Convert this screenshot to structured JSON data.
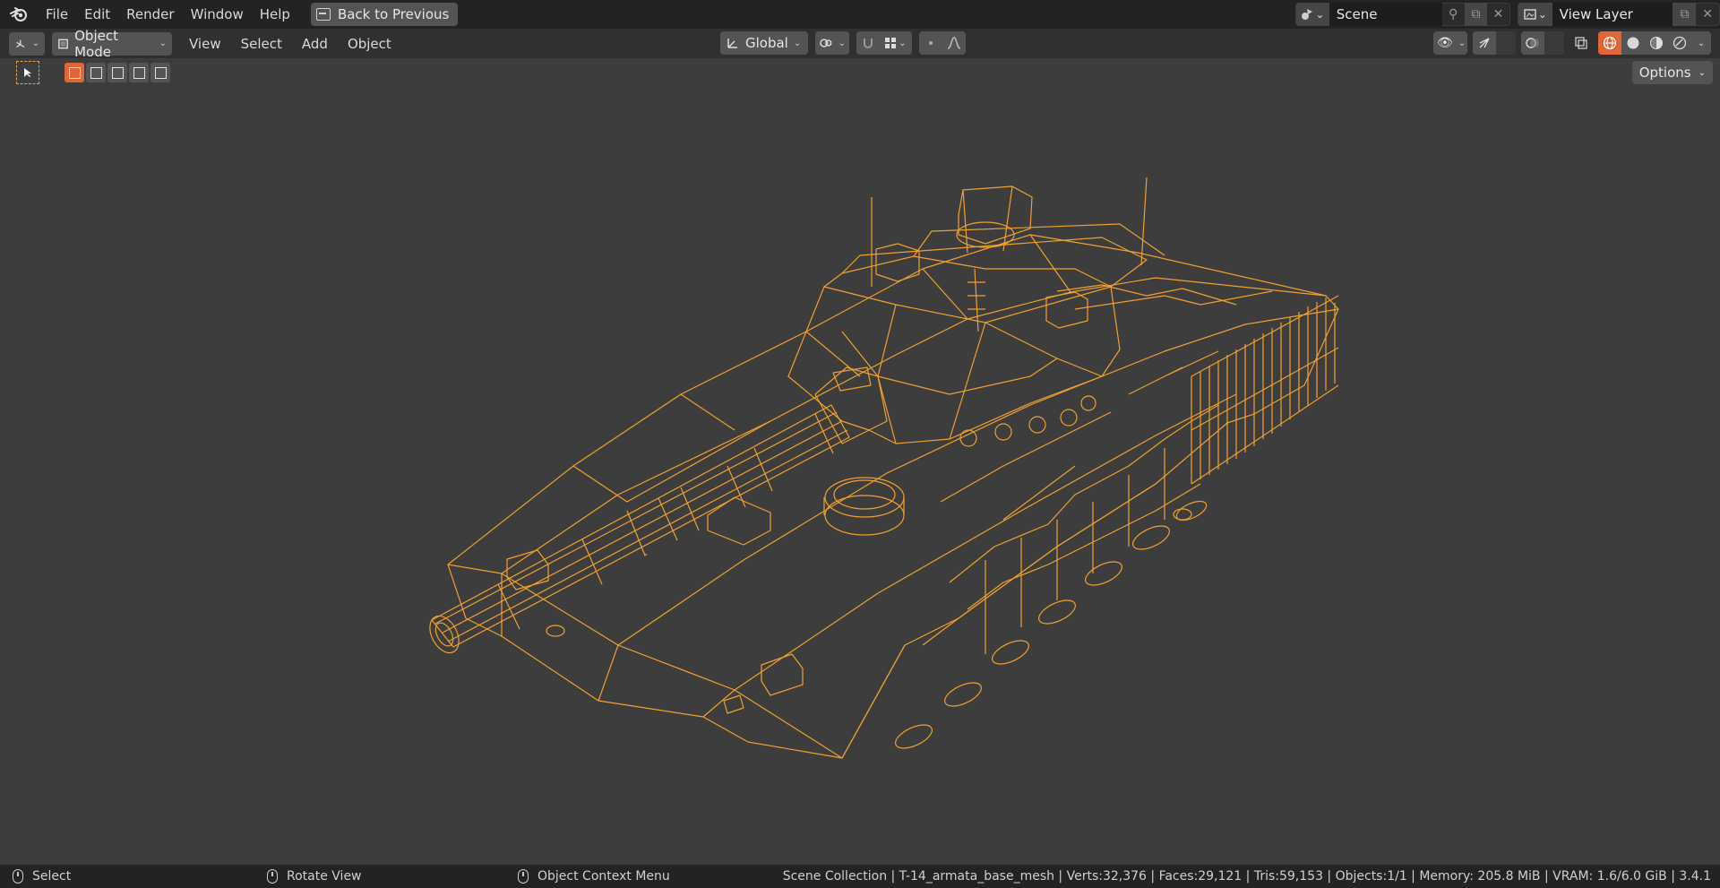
{
  "topbar": {
    "menus": [
      "File",
      "Edit",
      "Render",
      "Window",
      "Help"
    ],
    "back_label": "Back to Previous",
    "scene_label": "Scene",
    "view_layer_label": "View Layer"
  },
  "header": {
    "mode_label": "Object Mode",
    "menus": [
      "View",
      "Select",
      "Add",
      "Object"
    ],
    "transform_orientation": "Global"
  },
  "toolrow": {
    "options_label": "Options"
  },
  "viewport": {
    "object_name": "T-14_armata_base_mesh",
    "wire_color": "#f0a030",
    "background": "#3d3d3d"
  },
  "statusbar": {
    "hints": [
      {
        "label": "Select"
      },
      {
        "label": "Rotate View"
      },
      {
        "label": "Object Context Menu"
      }
    ],
    "info": "Scene Collection | T-14_armata_base_mesh | Verts:32,376 | Faces:29,121 | Tris:59,153 | Objects:1/1 | Memory: 205.8 MiB | VRAM: 1.6/6.0 GiB | 3.4.1"
  }
}
